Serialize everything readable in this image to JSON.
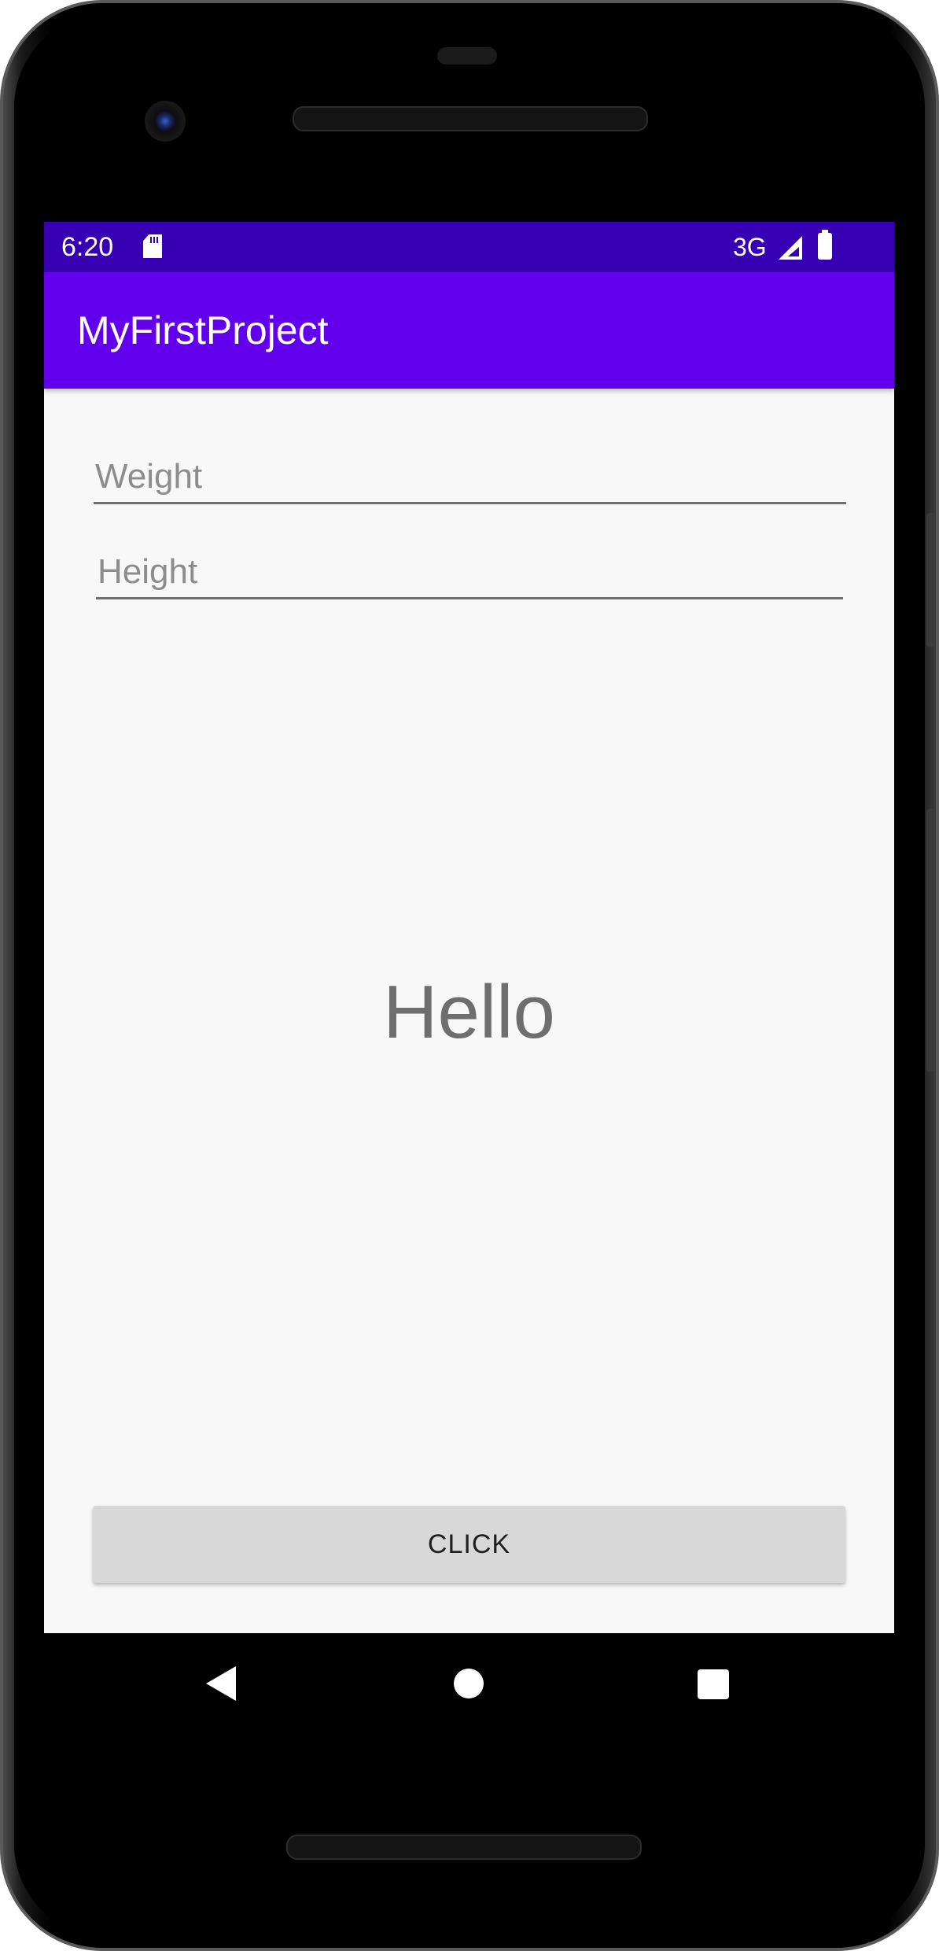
{
  "status_bar": {
    "time": "6:20",
    "network": "3G",
    "icons": [
      "sd-card-icon",
      "signal-icon",
      "battery-icon"
    ],
    "background": "#3700b3"
  },
  "app_bar": {
    "title": "MyFirstProject",
    "background": "#6200ee"
  },
  "form": {
    "weight_placeholder": "Weight",
    "height_placeholder": "Height"
  },
  "main": {
    "result_text": "Hello"
  },
  "button": {
    "label": "CLICK"
  },
  "nav_bar": {
    "icons": [
      "back-icon",
      "home-icon",
      "recents-icon"
    ]
  }
}
